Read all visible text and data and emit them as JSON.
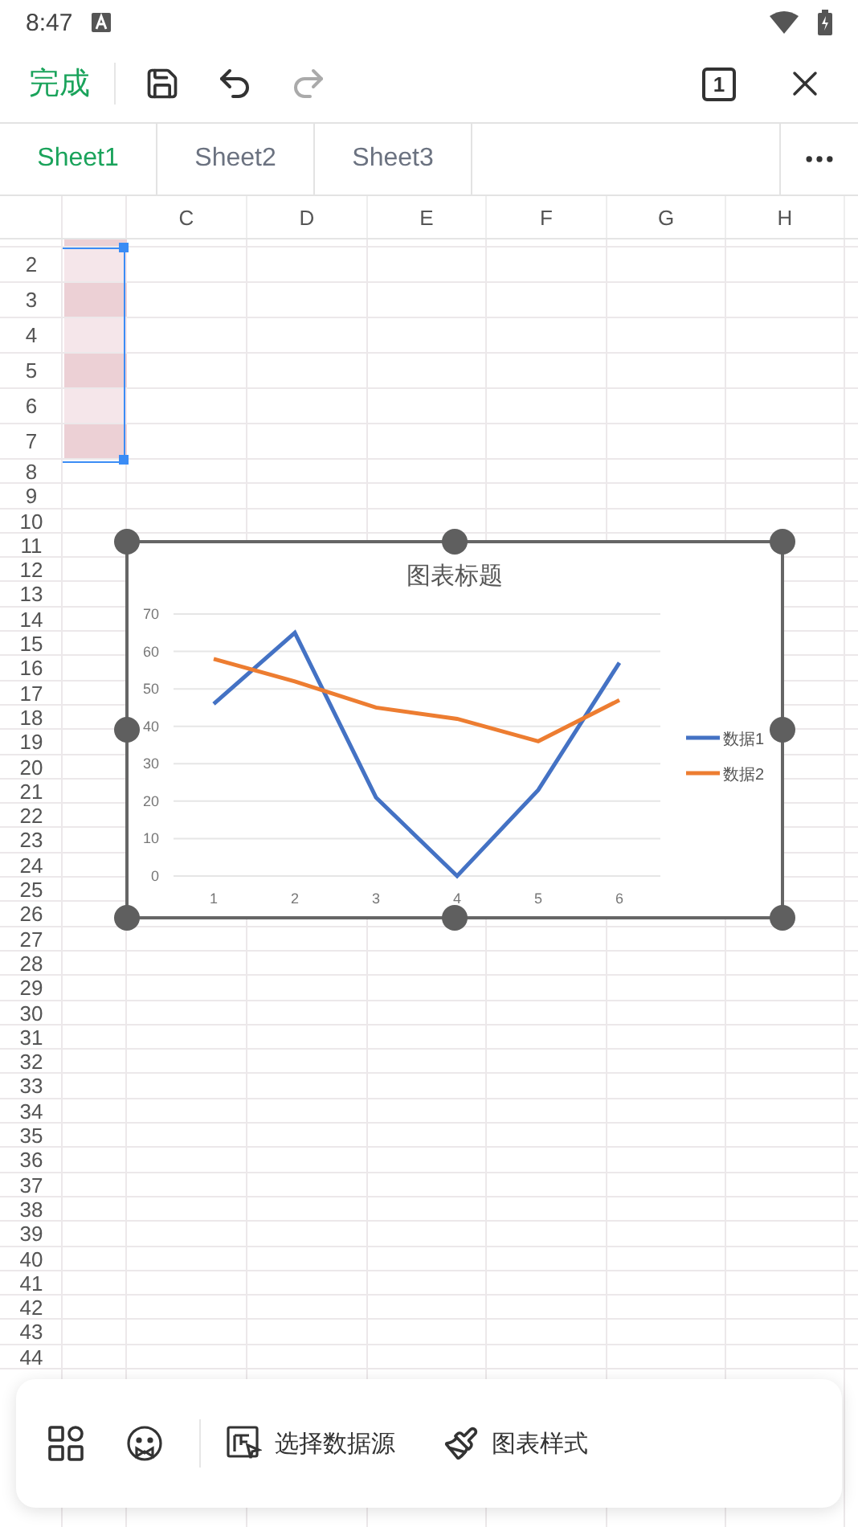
{
  "status_bar": {
    "time": "8:47"
  },
  "toolbar": {
    "done_label": "完成",
    "undo_disabled": false,
    "redo_disabled": true,
    "sheet_count": "1"
  },
  "tabs": [
    {
      "label": "Sheet1",
      "selected": true
    },
    {
      "label": "Sheet2",
      "selected": false
    },
    {
      "label": "Sheet3",
      "selected": false
    }
  ],
  "sheet": {
    "columns": [
      "C",
      "D",
      "E",
      "F",
      "G",
      "H"
    ],
    "rows": [
      {
        "label": "2",
        "color": "#f5e6ea"
      },
      {
        "label": "3",
        "color": "#ecd0d5"
      },
      {
        "label": "4",
        "color": "#f5e6ea"
      },
      {
        "label": "5",
        "color": "#ecd0d5"
      },
      {
        "label": "6",
        "color": "#f5e6ea"
      },
      {
        "label": "7",
        "color": "#ecd0d5"
      },
      {
        "label": "8"
      },
      {
        "label": "9"
      },
      {
        "label": "10"
      },
      {
        "label": "11"
      },
      {
        "label": "12"
      },
      {
        "label": "13"
      },
      {
        "label": "14"
      },
      {
        "label": "15"
      },
      {
        "label": "16"
      },
      {
        "label": "17"
      },
      {
        "label": "18"
      },
      {
        "label": "19"
      },
      {
        "label": "20"
      },
      {
        "label": "21"
      },
      {
        "label": "22"
      },
      {
        "label": "23"
      },
      {
        "label": "24"
      },
      {
        "label": "25"
      },
      {
        "label": "26"
      },
      {
        "label": "27"
      },
      {
        "label": "28"
      },
      {
        "label": "29"
      },
      {
        "label": "30"
      },
      {
        "label": "31"
      },
      {
        "label": "32"
      },
      {
        "label": "33"
      },
      {
        "label": "34"
      },
      {
        "label": "35"
      },
      {
        "label": "36"
      },
      {
        "label": "37"
      },
      {
        "label": "38"
      },
      {
        "label": "39"
      },
      {
        "label": "40"
      },
      {
        "label": "41"
      },
      {
        "label": "42"
      },
      {
        "label": "43"
      },
      {
        "label": "44"
      }
    ]
  },
  "chart": {
    "selected": true,
    "chart_data": {
      "type": "line",
      "title": "图表标题",
      "categories": [
        "1",
        "2",
        "3",
        "4",
        "5",
        "6"
      ],
      "series": [
        {
          "name": "数据1",
          "color": "#4472c4",
          "values": [
            46,
            65,
            21,
            0,
            23,
            57
          ]
        },
        {
          "name": "数据2",
          "color": "#ed7d31",
          "values": [
            58,
            52,
            45,
            42,
            36,
            47
          ]
        }
      ],
      "ylim": [
        0,
        70
      ],
      "grid": true,
      "legend": "right",
      "yticks": [
        0,
        10,
        20,
        30,
        40,
        50,
        60,
        70
      ]
    }
  },
  "bottom_bar": {
    "actions": [
      {
        "label": "选择数据源"
      },
      {
        "label": "图表样式"
      }
    ]
  }
}
